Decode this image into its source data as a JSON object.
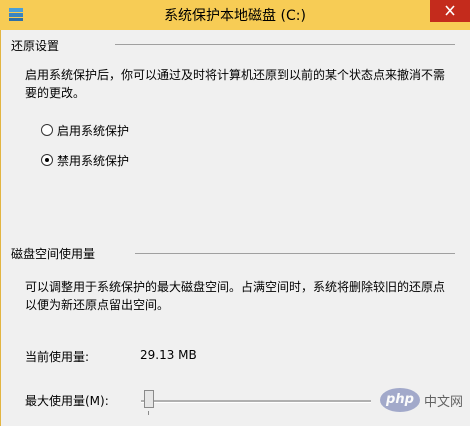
{
  "window": {
    "title": "系统保护本地磁盘 (C:)"
  },
  "restore": {
    "header": "还原设置",
    "description": "启用系统保护后，你可以通过及时将计算机还原到以前的某个状态点来撤消不需要的更改。",
    "options": [
      {
        "label": "启用系统保护",
        "checked": false
      },
      {
        "label": "禁用系统保护",
        "checked": true
      }
    ]
  },
  "disk": {
    "header": "磁盘空间使用量",
    "description": "可以调整用于系统保护的最大磁盘空间。占满空间时，系统将删除较旧的还原点以便为新还原点留出空间。",
    "current_label": "当前使用量:",
    "current_value": "29.13 MB",
    "max_label": "最大使用量(M):",
    "max_slider_percent": 0
  },
  "watermark": {
    "logo": "php",
    "text": "中文网"
  },
  "colors": {
    "titlebar": "#f7cc55",
    "close": "#c42b1c",
    "window_bg": "#f0f0f0"
  },
  "icons": {
    "title": "system-protection-icon",
    "close": "close-icon"
  }
}
